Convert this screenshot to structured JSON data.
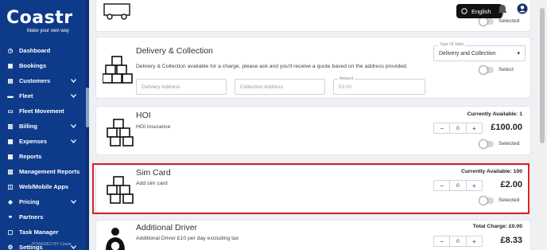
{
  "app": {
    "logo_text": "Coastr",
    "logo_tagline": "Make your own way",
    "powered": "POWERED BY Coastr"
  },
  "header": {
    "language": "English"
  },
  "sidebar": {
    "items": [
      {
        "label": "Dashboard",
        "icon": "dashboard-icon",
        "chevron": false
      },
      {
        "label": "Bookings",
        "icon": "bookings-icon",
        "chevron": false
      },
      {
        "label": "Customers",
        "icon": "customers-icon",
        "chevron": true
      },
      {
        "label": "Fleet",
        "icon": "car-icon",
        "chevron": true
      },
      {
        "label": "Fleet Movement",
        "icon": "truck-icon",
        "chevron": false
      },
      {
        "label": "Billing",
        "icon": "billing-icon",
        "chevron": true
      },
      {
        "label": "Expenses",
        "icon": "expenses-icon",
        "chevron": true
      },
      {
        "label": "Reports",
        "icon": "reports-icon",
        "chevron": false
      },
      {
        "label": "Management Reports",
        "icon": "management-reports-icon",
        "chevron": false
      },
      {
        "label": "Web/Mobile Apps",
        "icon": "apps-icon",
        "chevron": false
      },
      {
        "label": "Pricing",
        "icon": "pricing-icon",
        "chevron": true
      },
      {
        "label": "Partners",
        "icon": "partners-icon",
        "chevron": false
      },
      {
        "label": "Task Manager",
        "icon": "task-icon",
        "chevron": false
      },
      {
        "label": "Settings",
        "icon": "settings-icon",
        "chevron": true
      }
    ]
  },
  "cards": {
    "top": {
      "toggle_label": "Selected"
    },
    "delivery": {
      "title": "Delivery & Collection",
      "desc": "Delivery & Collection available for a charge, please ask and you'll receive a quote based on the address provided.",
      "delivery_placeholder": "Delivery Address",
      "collection_placeholder": "Collection Address",
      "amount_label": "Amount",
      "amount_value": "£0.00",
      "type_label": "Type Of Valet",
      "type_value": "Delivery and Collection",
      "toggle_label": "Select"
    },
    "hoi": {
      "title": "HOI",
      "desc": "HOI insurance",
      "availability": "Currently Available: 1",
      "qty": "0",
      "price": "£100.00",
      "toggle_label": "Selected"
    },
    "sim": {
      "title": "Sim Card",
      "desc": "Add sim card",
      "availability": "Currently Available: 100",
      "qty": "0",
      "price": "£2.00",
      "toggle_label": "Selected"
    },
    "driver": {
      "title": "Additional Driver",
      "desc": "Additional Driver £10 per day excluding tax",
      "total": "Total Charge: £0.00",
      "qty": "0",
      "price": "£8.33"
    }
  },
  "stepper": {
    "minus": "−",
    "plus": "+"
  },
  "colors": {
    "sidebar": "#0e3a8a",
    "highlight": "#e02020"
  }
}
